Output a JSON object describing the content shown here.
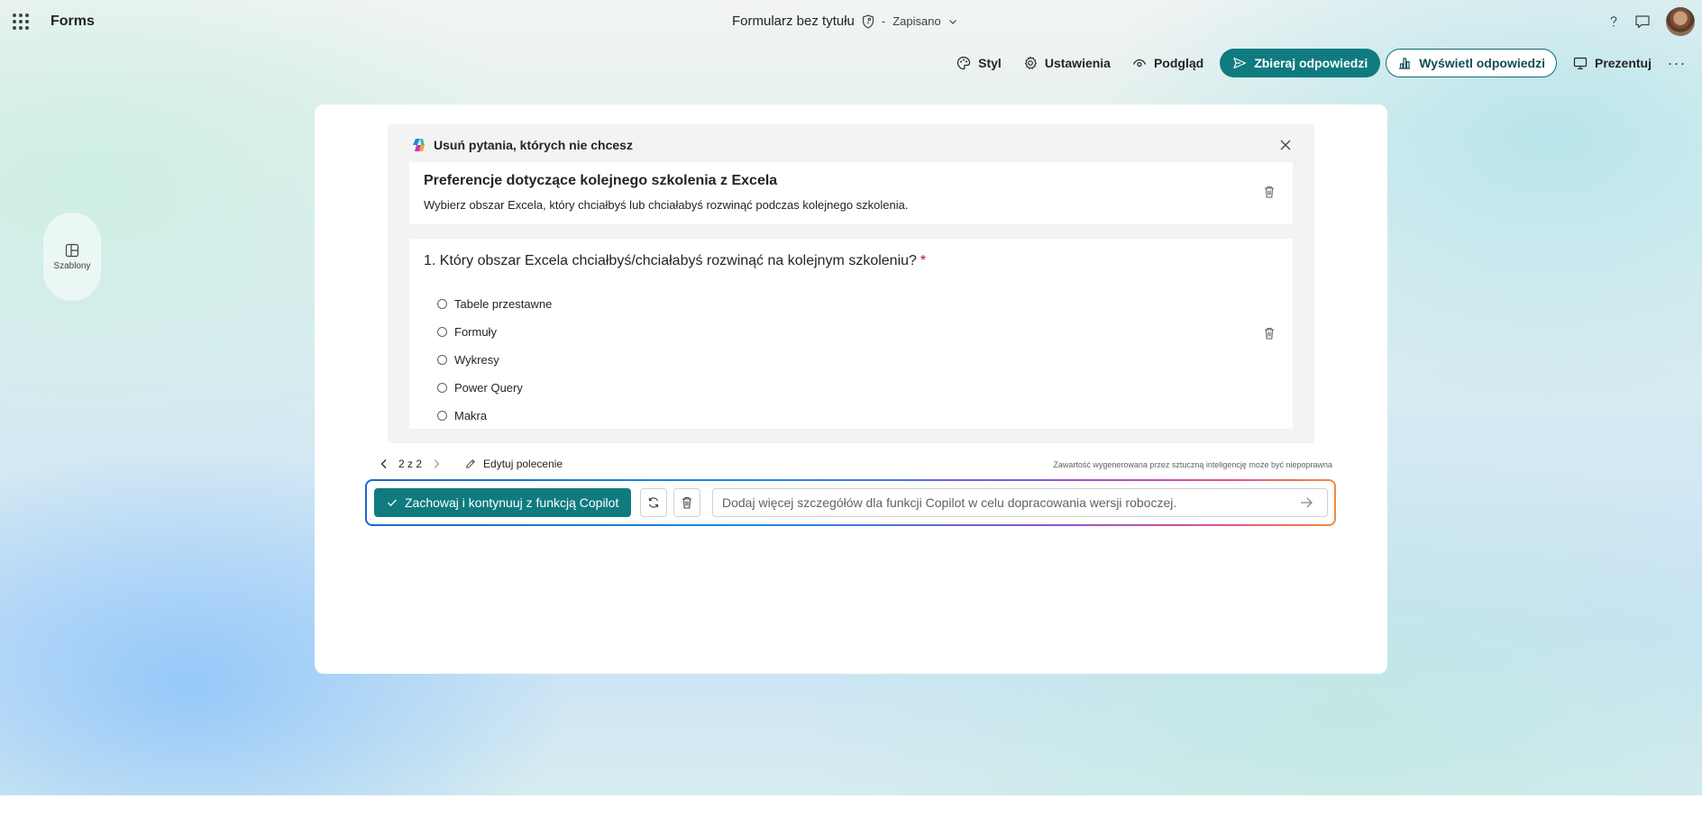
{
  "app": {
    "name": "Forms"
  },
  "document": {
    "title": "Formularz bez tytułu",
    "separator": "-",
    "status": "Zapisano"
  },
  "commands": {
    "style": "Styl",
    "settings": "Ustawienia",
    "preview": "Podgląd",
    "collect": "Zbieraj odpowiedzi",
    "view_responses": "Wyświetl odpowiedzi",
    "present": "Prezentuj",
    "more": "···"
  },
  "side": {
    "templates_label": "Szablony"
  },
  "suggestion": {
    "header": "Usuń pytania, których nie chcesz",
    "form_title": "Preferencje dotyczące kolejnego szkolenia z Excela",
    "form_description": "Wybierz obszar Excela, który chciałbyś lub chciałabyś rozwinąć podczas kolejnego szkolenia.",
    "question": {
      "text": "1. Który obszar Excela chciałbyś/chciałabyś rozwinąć na kolejnym szkoleniu?",
      "required_mark": "*",
      "options": [
        "Tabele przestawne",
        "Formuły",
        "Wykresy",
        "Power Query",
        "Makra"
      ]
    }
  },
  "pager": {
    "label": "2 z 2",
    "edit_prompt": "Edytuj polecenie"
  },
  "disclaimer": "Zawartość wygenerowana przez sztuczną inteligencję może być niepoprawna",
  "composer": {
    "keep_label": "Zachowaj i kontynuuj z funkcją Copilot",
    "placeholder": "Dodaj więcej szczegółów dla funkcji Copilot w celu dopracowania wersji roboczej."
  },
  "colors": {
    "accent": "#0f7b7f",
    "required": "#c50f1f"
  }
}
